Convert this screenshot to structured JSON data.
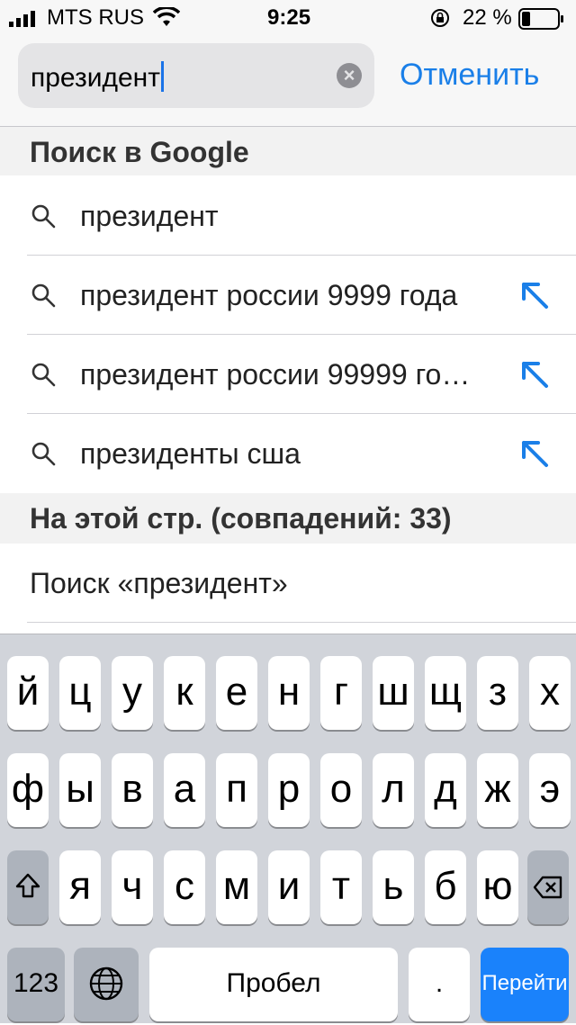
{
  "status_bar": {
    "carrier": "MTS RUS",
    "time": "9:25",
    "battery": "22 %"
  },
  "search": {
    "query": "президент",
    "cancel_label": "Отменить",
    "clear_icon": "clear-circle-icon"
  },
  "google_section": {
    "title": "Поиск в Google",
    "suggestions": [
      {
        "text": "президент",
        "has_arrow": false
      },
      {
        "text": "президент россии 9999 года",
        "has_arrow": true
      },
      {
        "text": "президент россии 99999 го…",
        "has_arrow": true
      },
      {
        "text": "президенты сша",
        "has_arrow": true
      }
    ]
  },
  "page_section": {
    "title": "На этой стр. (совпадений: 33)",
    "find_label": "Поиск «президент»"
  },
  "keyboard": {
    "row1": [
      "й",
      "ц",
      "у",
      "к",
      "е",
      "н",
      "г",
      "ш",
      "щ",
      "з",
      "х"
    ],
    "row2": [
      "ф",
      "ы",
      "в",
      "а",
      "п",
      "р",
      "о",
      "л",
      "д",
      "ж",
      "э"
    ],
    "row3": [
      "я",
      "ч",
      "с",
      "м",
      "и",
      "т",
      "ь",
      "б",
      "ю"
    ],
    "numbers_label": "123",
    "space_label": "Пробел",
    "period_label": ".",
    "go_label": "Перейти"
  },
  "colors": {
    "accent": "#1a7fe8",
    "go_key": "#1a82fb"
  }
}
